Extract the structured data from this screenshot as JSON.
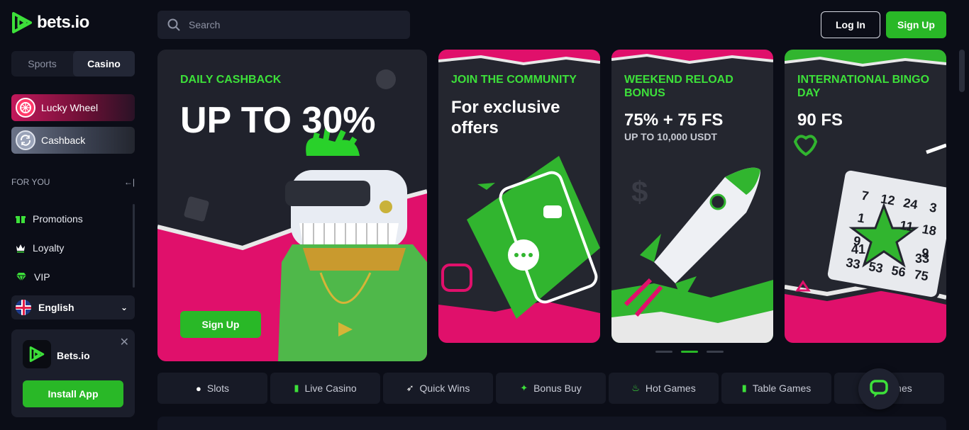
{
  "brand": {
    "name": "bets.io",
    "accent": "#29b827"
  },
  "sidebar": {
    "tabs": [
      {
        "label": "Sports",
        "active": false
      },
      {
        "label": "Casino",
        "active": true
      }
    ],
    "promos": [
      {
        "label": "Lucky Wheel",
        "icon": "wheel-icon"
      },
      {
        "label": "Cashback",
        "icon": "cashback-icon"
      }
    ],
    "section_title": "FOR YOU",
    "collapse_icon": "←|",
    "items": [
      {
        "label": "Promotions",
        "icon": "gift-icon"
      },
      {
        "label": "Loyalty",
        "icon": "crown-icon"
      },
      {
        "label": "VIP",
        "icon": "diamond-icon"
      }
    ],
    "language": "English",
    "app_card": {
      "name": "Bets.io",
      "button": "Install App"
    }
  },
  "header": {
    "search_placeholder": "Search",
    "login": "Log In",
    "signup": "Sign Up"
  },
  "banners": [
    {
      "tag": "DAILY CASHBACK",
      "headline": "UP TO 30%",
      "button": "Sign Up"
    },
    {
      "tag": "JOIN THE COMMUNITY",
      "headline_line1": "For exclusive",
      "headline_line2": "offers"
    },
    {
      "tag_line1": "WEEKEND RELOAD",
      "tag_line2": "BONUS",
      "headline": "75% + 75 FS",
      "sub": "UP TO 10,000 USDT"
    },
    {
      "tag_line1": "INTERNATIONAL BINGO",
      "tag_line2": "DAY",
      "headline": "90 FS",
      "bingo_numbers": [
        "7",
        "12",
        "24",
        "3",
        "1",
        "11",
        "18",
        "9",
        "9",
        "41",
        "33",
        "33",
        "53",
        "56",
        "75"
      ]
    }
  ],
  "carousel": {
    "active_index": 1,
    "count": 3
  },
  "categories": [
    {
      "label": "Slots",
      "icon": "cherry-icon"
    },
    {
      "label": "Live Casino",
      "icon": "card-icon"
    },
    {
      "label": "Quick Wins",
      "icon": "rocket-icon"
    },
    {
      "label": "Bonus Buy",
      "icon": "bonus-icon"
    },
    {
      "label": "Hot Games",
      "icon": "flame-icon"
    },
    {
      "label": "Table Games",
      "icon": "card-icon"
    },
    {
      "label": "Games",
      "icon": "chip-icon"
    }
  ]
}
